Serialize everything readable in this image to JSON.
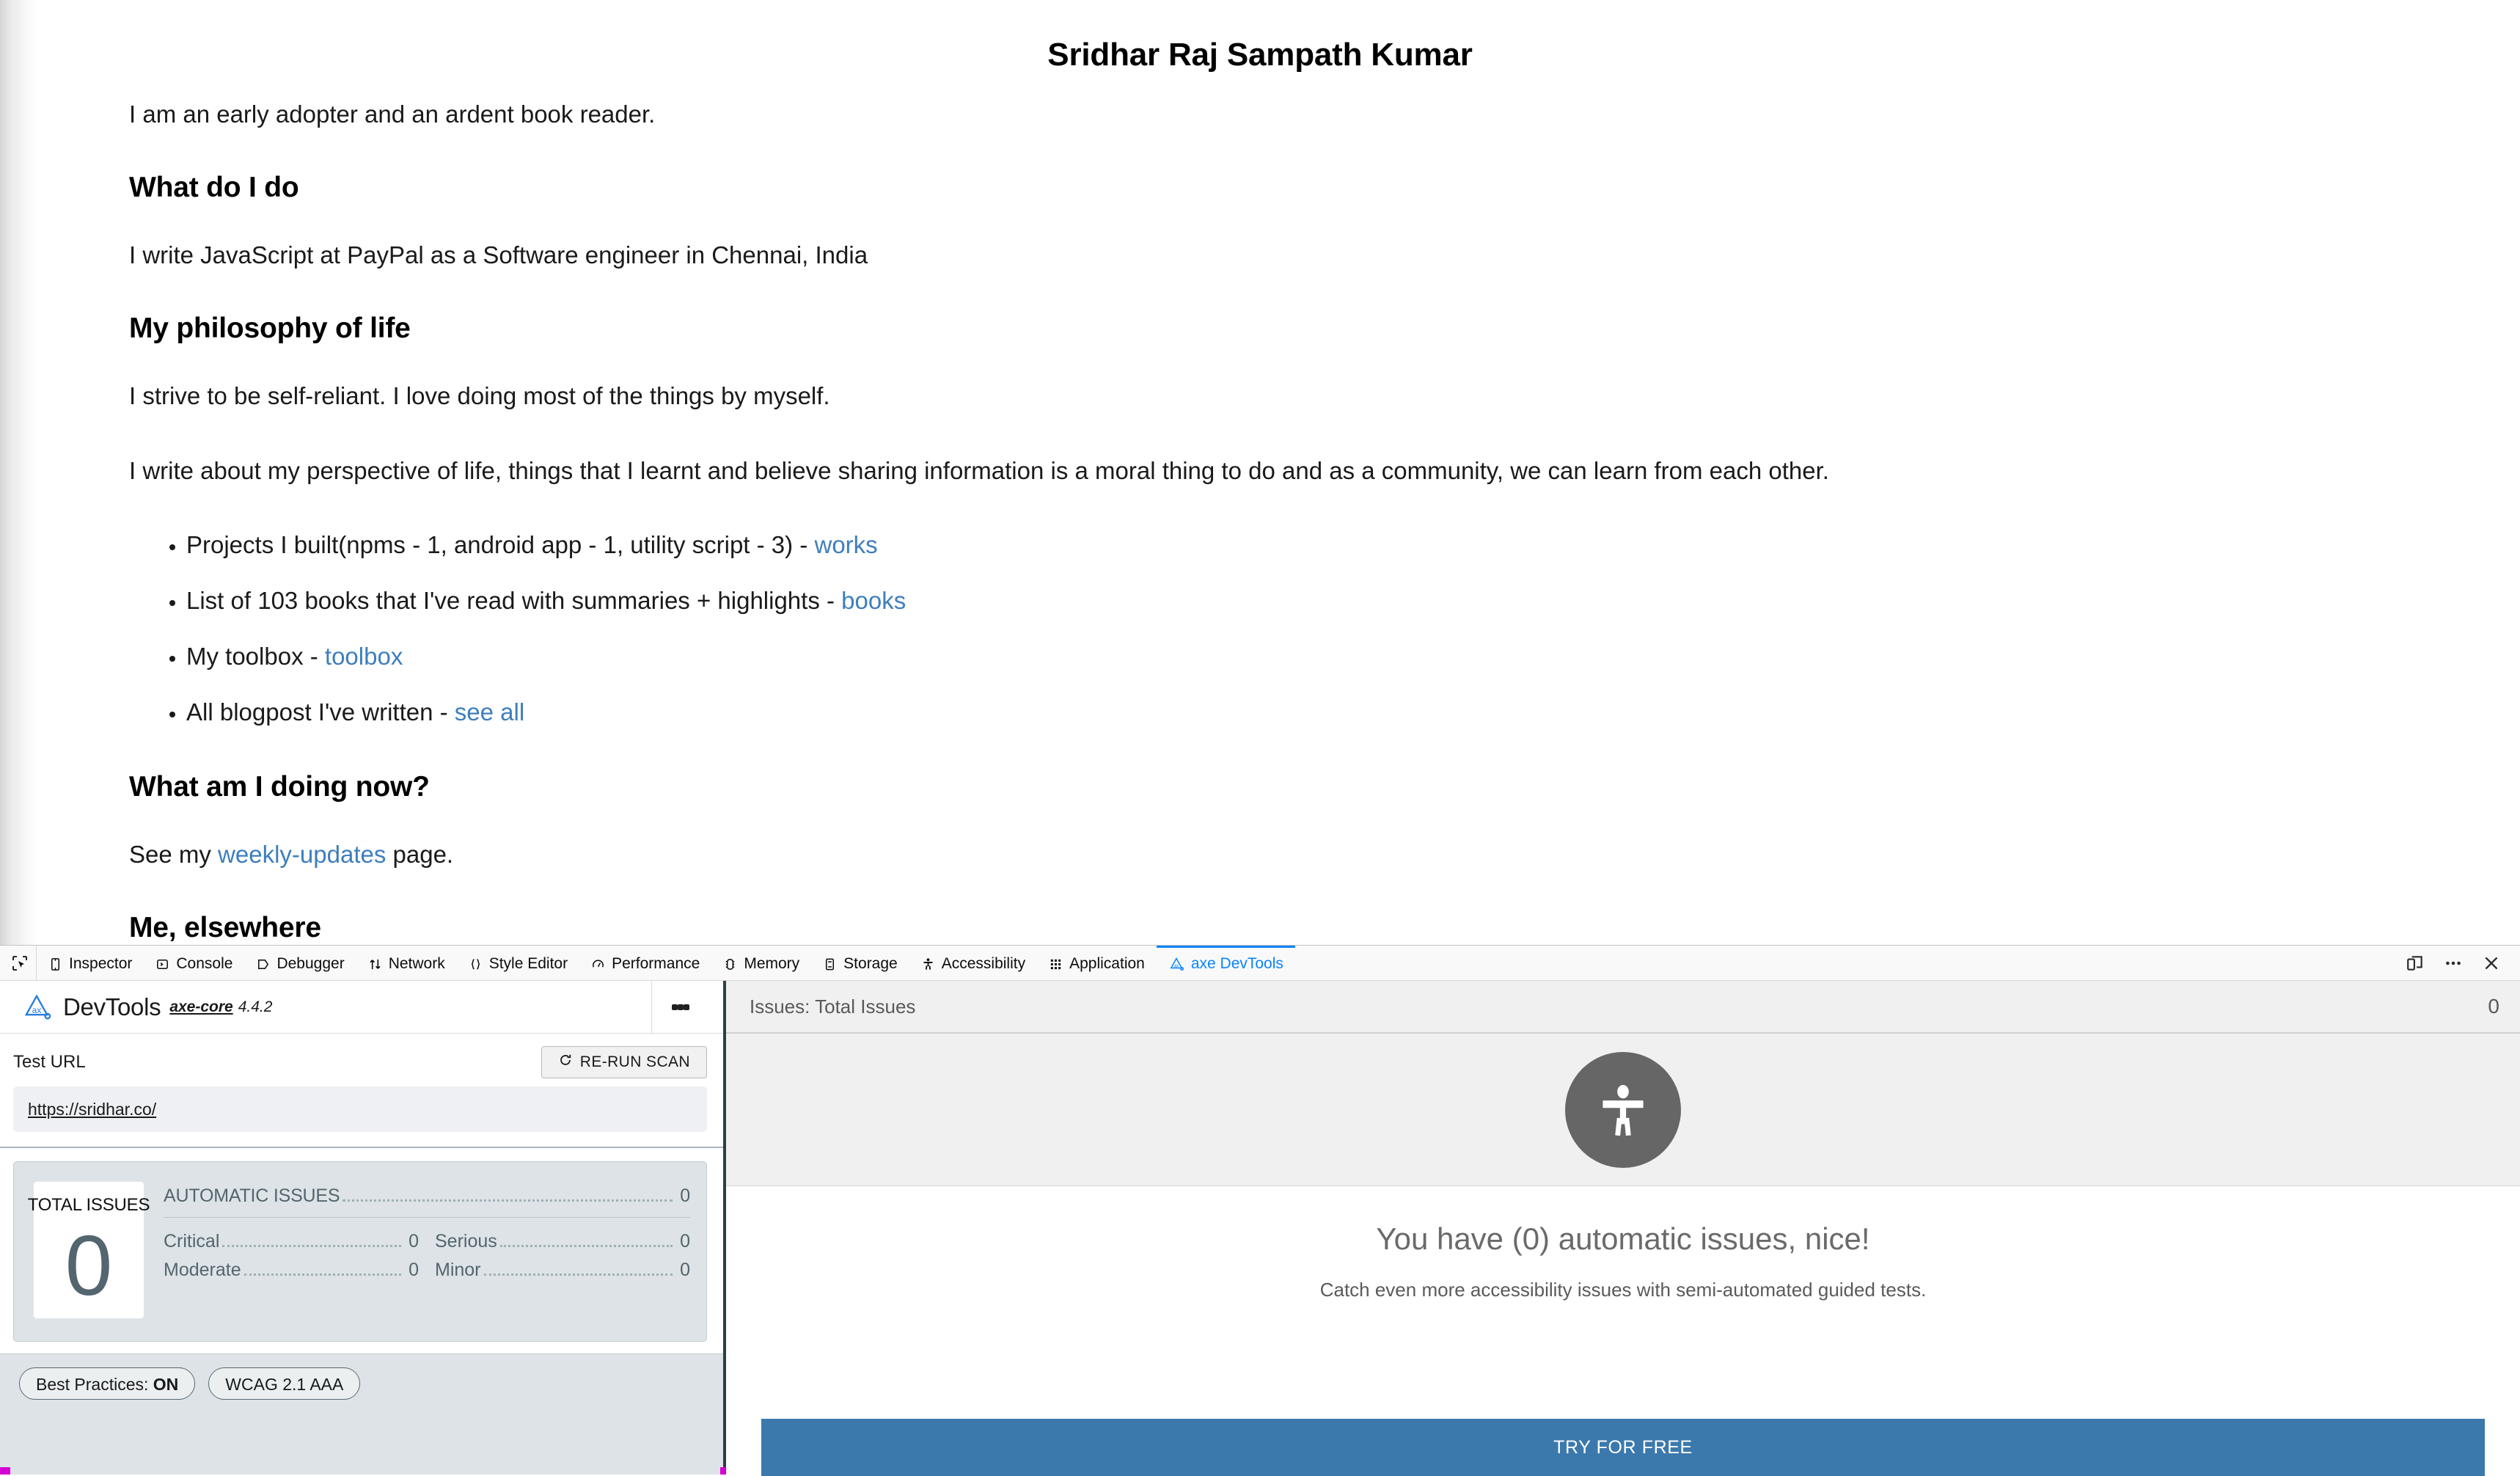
{
  "page": {
    "title": "Sridhar Raj Sampath Kumar",
    "intro": "I am an early adopter and an ardent book reader.",
    "sections": [
      {
        "heading": "What do I do",
        "paragraph": "I write JavaScript at PayPal as a Software engineer in Chennai, India"
      },
      {
        "heading": "My philosophy of life",
        "paragraph1": "I strive to be self-reliant. I love doing most of the things by myself.",
        "paragraph2": "I write about my perspective of life, things that I learnt and believe sharing information is a moral thing to do and as a community, we can learn from each other."
      },
      {
        "heading": "What am I doing now?",
        "see_prefix": "See my ",
        "see_link": "weekly-updates",
        "see_suffix": " page."
      },
      {
        "heading": "Me, elsewhere"
      }
    ],
    "bullets": [
      {
        "text": "Projects I built(npms - 1, android app - 1, utility script - 3) - ",
        "link": "works"
      },
      {
        "text": "List of 103 books that I've read with summaries + highlights - ",
        "link": "books"
      },
      {
        "text": "My toolbox - ",
        "link": "toolbox"
      },
      {
        "text": "All blogpost I've written - ",
        "link": "see all"
      }
    ],
    "link_color": "#3d7ebd"
  },
  "devtools": {
    "tabs": [
      {
        "label": "Inspector",
        "icon": "inspector-icon",
        "active": false
      },
      {
        "label": "Console",
        "icon": "console-icon",
        "active": false
      },
      {
        "label": "Debugger",
        "icon": "debugger-icon",
        "active": false
      },
      {
        "label": "Network",
        "icon": "network-icon",
        "active": false
      },
      {
        "label": "Style Editor",
        "icon": "style-editor-icon",
        "active": false
      },
      {
        "label": "Performance",
        "icon": "performance-icon",
        "active": false
      },
      {
        "label": "Memory",
        "icon": "memory-icon",
        "active": false
      },
      {
        "label": "Storage",
        "icon": "storage-icon",
        "active": false
      },
      {
        "label": "Accessibility",
        "icon": "accessibility-icon",
        "active": false
      },
      {
        "label": "Application",
        "icon": "application-icon",
        "active": false
      },
      {
        "label": "axe DevTools",
        "icon": "axe-logo-icon",
        "active": true
      }
    ],
    "active_tab_color": "#0a84ff",
    "right_buttons": [
      {
        "name": "responsive-design-mode-icon"
      },
      {
        "name": "more-options-icon"
      },
      {
        "name": "close-icon"
      }
    ]
  },
  "axe": {
    "brand_name": "DevTools",
    "core_label": "axe-core",
    "version": "4.4.2",
    "test_url_label": "Test URL",
    "rerun_label": "RE-RUN SCAN",
    "url_value": "https://sridhar.co/",
    "summary": {
      "total_label": "TOTAL ISSUES",
      "total_value": "0",
      "automatic_label": "AUTOMATIC ISSUES",
      "automatic_value": "0",
      "severities": [
        {
          "label": "Critical",
          "value": "0"
        },
        {
          "label": "Serious",
          "value": "0"
        },
        {
          "label": "Moderate",
          "value": "0"
        },
        {
          "label": "Minor",
          "value": "0"
        }
      ]
    },
    "pills": [
      {
        "prefix": "Best Practices: ",
        "strong": "ON"
      },
      {
        "prefix": "WCAG 2.1 AAA",
        "strong": ""
      }
    ],
    "issues_header_label": "Issues: Total Issues",
    "issues_header_count": "0",
    "empty_state": {
      "title": "You have (0) automatic issues, nice!",
      "subtitle": "Catch even more accessibility issues with semi-automated guided tests.",
      "cta_label": "TRY FOR FREE",
      "cta_color": "#3b79ad"
    }
  }
}
